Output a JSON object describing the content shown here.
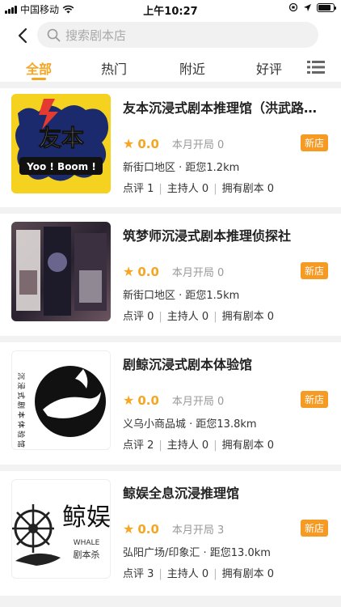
{
  "status_bar": {
    "carrier": "中国移动",
    "time": "上午10:27"
  },
  "search": {
    "placeholder": "搜索剧本店"
  },
  "tabs": [
    {
      "label": "全部",
      "active": true
    },
    {
      "label": "热门",
      "active": false
    },
    {
      "label": "附近",
      "active": false
    },
    {
      "label": "好评",
      "active": false
    }
  ],
  "colors": {
    "accent": "#f5a623",
    "badge": "#f59a23",
    "divider": "#f2f2f2"
  },
  "stores": [
    {
      "name": "友本沉浸式剧本推理馆（洪武路…",
      "rating": "0.0",
      "month_opens": "本月开局 0",
      "badge": "新店",
      "location": "新街口地区 · 距您1.2km",
      "reviews": "点评 1",
      "hosts": "主持人 0",
      "scripts": "拥有剧本 0",
      "thumb_text_main": "友本",
      "thumb_text_sub": "Yoo ! Boom !"
    },
    {
      "name": "筑梦师沉浸式剧本推理侦探社",
      "rating": "0.0",
      "month_opens": "本月开局 0",
      "badge": "新店",
      "location": "新街口地区 · 距您1.5km",
      "reviews": "点评 0",
      "hosts": "主持人 0",
      "scripts": "拥有剧本 0"
    },
    {
      "name": "剧鲸沉浸式剧本体验馆",
      "rating": "0.0",
      "month_opens": "本月开局 0",
      "badge": "新店",
      "location": "义乌小商品城 · 距您13.8km",
      "reviews": "点评 2",
      "hosts": "主持人 0",
      "scripts": "拥有剧本 0",
      "thumb_text_main": "沉浸式剧本体验馆"
    },
    {
      "name": "鲸娱全息沉浸推理馆",
      "rating": "0.0",
      "month_opens": "本月开局 3",
      "badge": "新店",
      "location": "弘阳广场/印象汇 · 距您13.0km",
      "reviews": "点评 3",
      "hosts": "主持人 0",
      "scripts": "拥有剧本 0",
      "thumb_text_main": "鲸娱",
      "thumb_text_sub": "WHALE",
      "thumb_text_sub2": "剧本杀"
    }
  ]
}
